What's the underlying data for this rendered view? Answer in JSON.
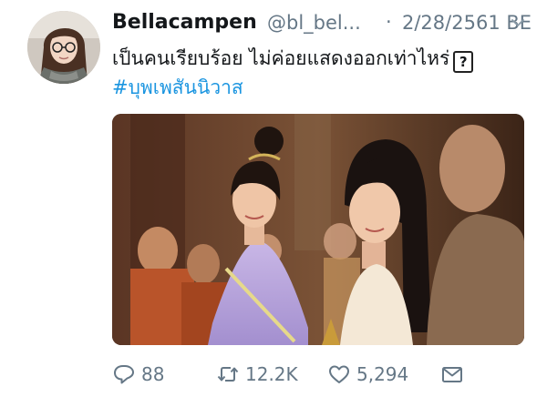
{
  "tweet": {
    "author": {
      "display_name": "Bellacampen",
      "handle": "@bl_bel...",
      "avatar_icon": "profile-photo"
    },
    "separator": "·",
    "timestamp": "2/28/2561 BE",
    "text_line1": "เป็นคนเรียบร้อย ไม่ค่อยแสดงออกเท่าไหร่",
    "text_emoji": "?",
    "hashtag": "#บุพเพสันนิวาส",
    "media_icon": "photo-two-women-in-thai-traditional-dress",
    "actions": {
      "reply_icon": "reply-icon",
      "reply_count": "88",
      "retweet_icon": "retweet-icon",
      "retweet_count": "12.2K",
      "like_icon": "heart-icon",
      "like_count": "5,294",
      "dm_icon": "envelope-icon"
    },
    "colors": {
      "text": "#14171a",
      "secondary": "#657786",
      "link": "#1b95e0"
    }
  }
}
